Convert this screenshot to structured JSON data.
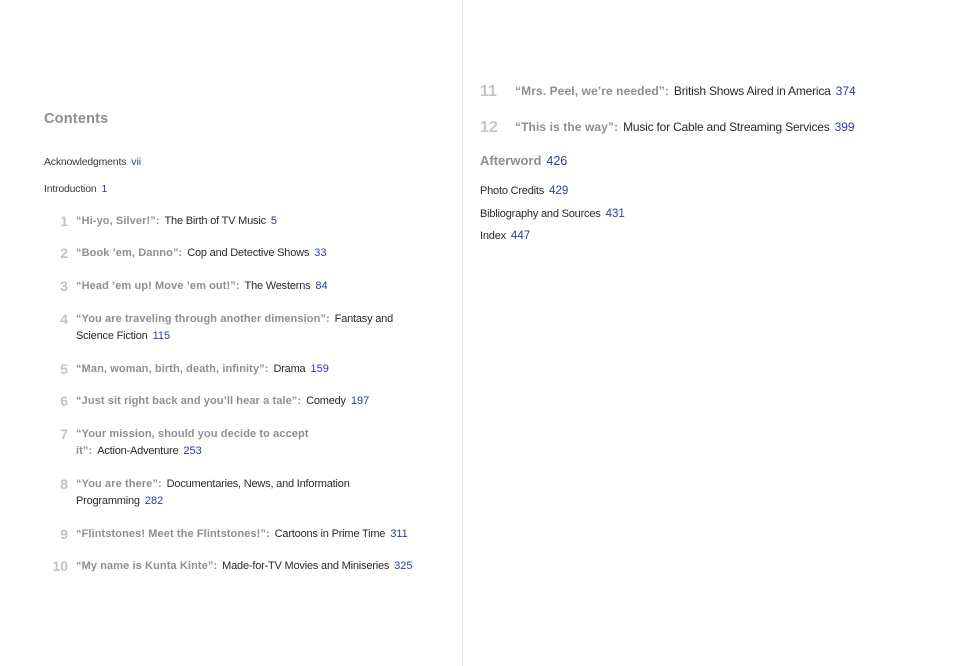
{
  "left_page": {
    "title": "Contents",
    "front_matter": [
      {
        "label": "Acknowledgments",
        "page": "vii"
      },
      {
        "label": "Introduction",
        "page": "1"
      }
    ],
    "chapters": [
      {
        "num": "1",
        "quote": "“Hi-yo, Silver!”",
        "subtitle": "The Birth of TV Music",
        "page": "5"
      },
      {
        "num": "2",
        "quote": "“Book ’em, Danno”",
        "subtitle": "Cop and Detective Shows",
        "page": "33"
      },
      {
        "num": "3",
        "quote": "“Head ’em up! Move ’em out!”",
        "subtitle": "The Westerns",
        "page": "84"
      },
      {
        "num": "4",
        "quote": "“You are traveling through another dimension”",
        "subtitle": "Fantasy and",
        "subtitle_cont": "Science Fiction",
        "page": "115"
      },
      {
        "num": "5",
        "quote": "“Man, woman, birth, death, infinity”",
        "subtitle": "Drama",
        "page": "159"
      },
      {
        "num": "6",
        "quote": "“Just sit right back and you’ll hear a tale”",
        "subtitle": "Comedy",
        "page": "197"
      },
      {
        "num": "7",
        "quote": "“Your mission, should you decide to accept",
        "quote_cont": "it”",
        "subtitle": "Action-Adventure",
        "page": "253"
      },
      {
        "num": "8",
        "quote": "“You are there”",
        "subtitle": "Documentaries, News, and Information",
        "subtitle_cont": "Programming",
        "page": "282"
      },
      {
        "num": "9",
        "quote": "“Flintstones! Meet the Flintstones!”",
        "subtitle": "Cartoons in Prime Time",
        "page": "311"
      },
      {
        "num": "10",
        "quote": "“My name is Kunta Kinte”",
        "subtitle": "Made-for-TV Movies and Miniseries",
        "page": "325"
      }
    ]
  },
  "right_page": {
    "chapters": [
      {
        "num": "11",
        "quote": "“Mrs. Peel, we’re needed”",
        "subtitle": "British Shows Aired in America",
        "page": "374"
      },
      {
        "num": "12",
        "quote": "“This is the way”",
        "subtitle": "Music for Cable and Streaming Services",
        "page": "399"
      }
    ],
    "afterword": {
      "label": "Afterword",
      "page": "426"
    },
    "back_matter": [
      {
        "label": "Photo Credits",
        "page": "429"
      },
      {
        "label": "Bibliography and Sources",
        "page": "431"
      },
      {
        "label": "Index",
        "page": "447"
      }
    ]
  },
  "colors": {
    "page_number": "#2b3d9a",
    "heading_gray": "#8e8e8e",
    "chapter_number_gray": "#c2c2c2",
    "text": "#2a2a2a"
  }
}
